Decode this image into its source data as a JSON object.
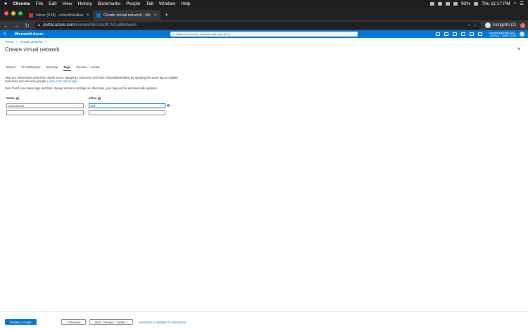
{
  "mac_menu": {
    "apple": "",
    "items": [
      "Chrome",
      "File",
      "Edit",
      "View",
      "History",
      "Bookmarks",
      "People",
      "Tab",
      "Window",
      "Help"
    ],
    "battery": "93%",
    "clock": "Thu 11:17 PM"
  },
  "browser": {
    "tabs": [
      {
        "title": "Inbox (528) - rahulshivalkar9@...",
        "favicon_color": "#d93025"
      },
      {
        "title": "Create virtual network - Micro...",
        "favicon_color": "#0078d4"
      }
    ],
    "new_tab": "+",
    "url_host": "portal.azure.com",
    "url_path": "/#create/Microsoft.VirtualNetwork",
    "incognito_label": "Incognito (2)"
  },
  "azure_header": {
    "brand": "Microsoft Azure",
    "search_placeholder": "Search resources, services, and docs (G+/)",
    "account_name": "rahulshivalkar9@Outlo...",
    "account_directory": "DEFAULT DIRECTORY"
  },
  "breadcrumb": [
    "Home",
    "Virtual networks"
  ],
  "page_title": "Create virtual network",
  "tabs": [
    {
      "label": "Basics",
      "active": false
    },
    {
      "label": "IP Addresses",
      "active": false
    },
    {
      "label": "Security",
      "active": false
    },
    {
      "label": "Tags",
      "active": true
    },
    {
      "label": "Review + create",
      "active": false
    }
  ],
  "description": {
    "text": "Tags are name/value pairs that enable you to categorize resources and view consolidated billing by applying the same tag to multiple resources and resource groups.",
    "link": "Learn more about tags"
  },
  "note": "Note that if you create tags and then change resource settings on other tabs, your tags will be automatically updated.",
  "tag_table": {
    "name_header": "Name",
    "value_header": "Value",
    "rows": [
      {
        "name": "environment",
        "value": "test"
      },
      {
        "name": "",
        "value": ""
      }
    ],
    "more": "..."
  },
  "footer": {
    "primary": "Review + create",
    "previous": "< Previous",
    "next": "Next : Review + create >",
    "template_link": "Download a template for automation"
  }
}
